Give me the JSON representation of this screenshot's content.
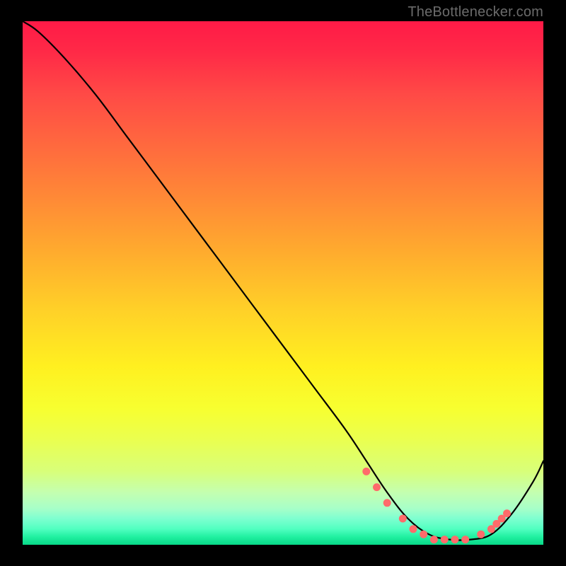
{
  "watermark": "TheBottlenecker.com",
  "chart_data": {
    "type": "line",
    "title": "",
    "xlabel": "",
    "ylabel": "",
    "xlim": [
      0,
      100
    ],
    "ylim": [
      0,
      100
    ],
    "series": [
      {
        "name": "bottleneck-curve",
        "x": [
          0,
          3,
          8,
          14,
          20,
          26,
          32,
          38,
          44,
          50,
          56,
          62,
          66,
          70,
          74,
          78,
          82,
          86,
          90,
          94,
          98,
          100
        ],
        "values": [
          100,
          98,
          93,
          86,
          78,
          70,
          62,
          54,
          46,
          38,
          30,
          22,
          16,
          10,
          5,
          2,
          1,
          1,
          2,
          6,
          12,
          16
        ]
      }
    ],
    "markers": {
      "name": "highlight-points",
      "color": "#ff6b6b",
      "x": [
        66,
        68,
        70,
        73,
        75,
        77,
        79,
        81,
        83,
        85,
        88,
        90,
        91,
        92,
        93
      ],
      "values": [
        14,
        11,
        8,
        5,
        3,
        2,
        1,
        1,
        1,
        1,
        2,
        3,
        4,
        5,
        6
      ]
    },
    "gradient_stops": [
      {
        "pos": 0,
        "color": "#ff1a47"
      },
      {
        "pos": 50,
        "color": "#ffd028"
      },
      {
        "pos": 80,
        "color": "#eaff50"
      },
      {
        "pos": 100,
        "color": "#08d888"
      }
    ]
  }
}
